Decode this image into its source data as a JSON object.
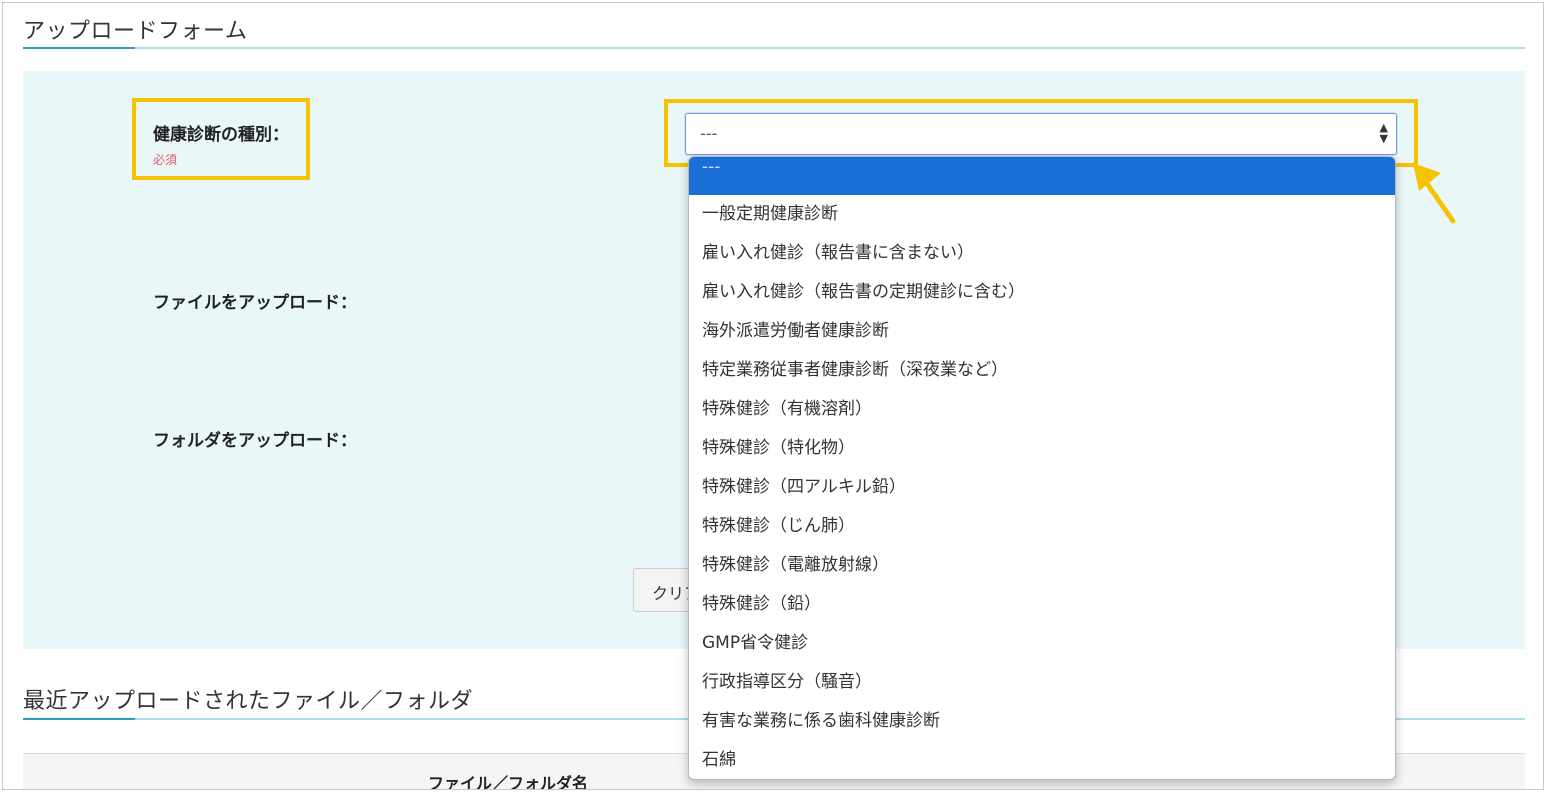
{
  "upload_form": {
    "title": "アップロードフォーム",
    "exam_type_label": "健康診断の種別：",
    "required_label": "必須",
    "exam_type_select": {
      "selected_value": "---",
      "options": [
        "---",
        "一般定期健康診断",
        "雇い入れ健診（報告書に含まない）",
        "雇い入れ健診（報告書の定期健診に含む）",
        "海外派遣労働者健康診断",
        "特定業務従事者健康診断（深夜業など）",
        "特殊健診（有機溶剤）",
        "特殊健診（特化物）",
        "特殊健診（四アルキル鉛）",
        "特殊健診（じん肺）",
        "特殊健診（電離放射線）",
        "特殊健診（鉛）",
        "GMP省令健診",
        "行政指導区分（騒音）",
        "有害な業務に係る歯科健康診断",
        "石綿"
      ]
    },
    "file_upload_label": "ファイルをアップロード：",
    "folder_upload_label": "フォルダをアップロード：",
    "clear_button_label": "クリア"
  },
  "recent_uploads": {
    "title": "最近アップロードされたファイル／フォルダ",
    "column_header": "ファイル／フォルダ名"
  },
  "colors": {
    "highlight": "#f5c400",
    "selected_option": "#1a6ed8",
    "panel_bg": "#eaf7f9",
    "required_text": "#e05b68"
  }
}
